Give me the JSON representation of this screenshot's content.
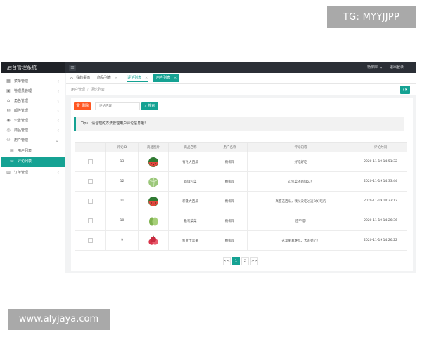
{
  "watermarks": {
    "top": "TG: MYYJJPP",
    "bottom": "www.alyjaya.com"
  },
  "header": {
    "brand": "后台管理系统",
    "menu_icon": "hamburger-icon",
    "user": "杨柳岸",
    "logout": "退出登录"
  },
  "sidebar": {
    "items": [
      {
        "label": "菜单管理",
        "icon": "grid-icon"
      },
      {
        "label": "管理员管理",
        "icon": "user-icon"
      },
      {
        "label": "角色管理",
        "icon": "home-icon"
      },
      {
        "label": "邮件管理",
        "icon": "mail-icon"
      },
      {
        "label": "公告管理",
        "icon": "eye-icon"
      },
      {
        "label": "商品管理",
        "icon": "globe-icon"
      },
      {
        "label": "用户管理",
        "icon": "person-icon"
      },
      {
        "label": "用户列表",
        "icon": "doc-icon"
      },
      {
        "label": "评论列表",
        "icon": "comment-icon"
      },
      {
        "label": "订单管理",
        "icon": "cart-icon"
      }
    ]
  },
  "tabs": [
    {
      "label": "我的桌面"
    },
    {
      "label": "商品列表"
    },
    {
      "label": "评论列表"
    },
    {
      "label": "用户列表"
    }
  ],
  "breadcrumb": {
    "parent": "用户管理",
    "current": "评论列表"
  },
  "toolbar": {
    "delete_label": "删除",
    "search_placeholder": "评论内容",
    "search_label": "搜索"
  },
  "tips": "Tips：请合理的方法管理用户评论信息哦!",
  "table": {
    "headers": [
      "评论ID",
      "商品图片",
      "商品名称",
      "用户名称",
      "评论内容",
      "评论时间"
    ],
    "rows": [
      {
        "id": "13",
        "image": "watermelon",
        "name": "有籽大西瓜",
        "user": "杨柳岸",
        "content": "好吃好吃",
        "time": "2020-11-19 14:51:32"
      },
      {
        "id": "12",
        "image": "cabbage",
        "name": "新鲜包菜",
        "user": "杨柳岸",
        "content": "这包菜还新鲜么？",
        "time": "2020-11-19 14:33:44"
      },
      {
        "id": "11",
        "image": "watermelon",
        "name": "新疆大西瓜",
        "user": "杨柳岸",
        "content": "真甜这西瓜，我从没吃过这么好吃的",
        "time": "2020-11-19 14:33:12"
      },
      {
        "id": "10",
        "image": "lettuce",
        "name": "散装菜菜",
        "user": "杨柳岸",
        "content": "还不错!",
        "time": "2020-11-19 14:26:36"
      },
      {
        "id": "9",
        "image": "apples",
        "name": "红富士苹果",
        "user": "杨柳岸",
        "content": "这苹果真难吃，太差劲了！",
        "time": "2020-11-19 14:26:22"
      }
    ]
  },
  "pagination": {
    "prev": "<<",
    "pages": [
      "1",
      "2"
    ],
    "current": "1",
    "next": ">>"
  },
  "colors": {
    "accent": "#15a293",
    "danger": "#ff5722",
    "topbar": "#2b2f36"
  }
}
